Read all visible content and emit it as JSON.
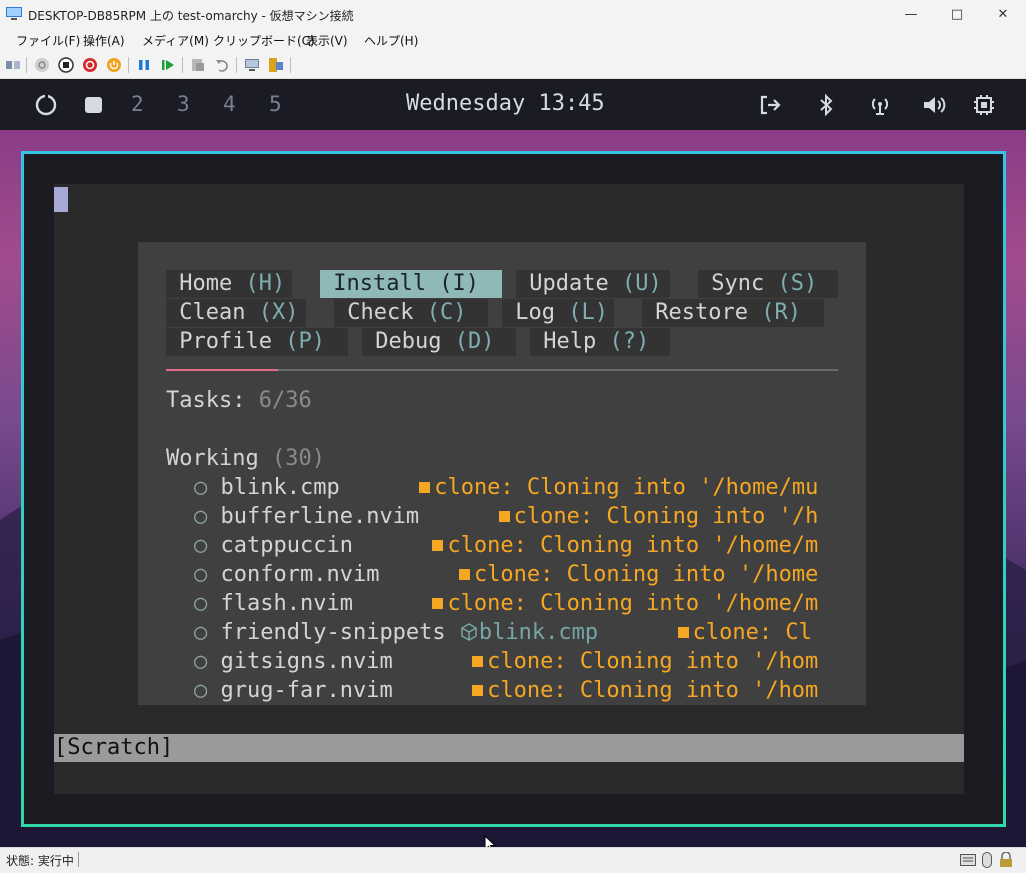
{
  "window": {
    "title": "DESKTOP-DB85RPM 上の test-omarchy - 仮想マシン接続",
    "minimize_icon": "minimize-icon",
    "maximize_icon": "maximize-icon",
    "close_icon": "close-icon"
  },
  "menu": [
    "ファイル(F)",
    "操作(A)",
    "メディア(M)",
    "クリップボード(C)",
    "表示(V)",
    "ヘルプ(H)"
  ],
  "toolbar": {
    "icons": [
      "ctrl-alt-del-icon",
      "start-icon",
      "turn-off-icon",
      "shutdown-icon",
      "power-icon",
      "pause-icon",
      "resume-icon",
      "checkpoint-icon",
      "revert-icon",
      "enhanced-session-icon",
      "share-icon"
    ]
  },
  "topbar": {
    "workspaces": [
      "2",
      "3",
      "4",
      "5"
    ],
    "clock": "Wednesday 13:45",
    "icons": [
      "logout-icon",
      "bluetooth-icon",
      "network-icon",
      "volume-icon",
      "cpu-icon"
    ]
  },
  "lazy": {
    "buttons": [
      {
        "label": "Home ",
        "key": "(H)",
        "active": false
      },
      {
        "label": "Install ",
        "key": "(I)",
        "active": true
      },
      {
        "label": "Update ",
        "key": "(U)",
        "active": false
      },
      {
        "label": "Sync ",
        "key": "(S)",
        "active": false
      },
      {
        "label": "Clean ",
        "key": "(X)",
        "active": false
      },
      {
        "label": "Check ",
        "key": "(C)",
        "active": false
      },
      {
        "label": "Log ",
        "key": "(L)",
        "active": false
      },
      {
        "label": "Restore ",
        "key": "(R)",
        "active": false
      },
      {
        "label": "Profile ",
        "key": "(P)",
        "active": false
      },
      {
        "label": "Debug ",
        "key": "(D)",
        "active": false
      },
      {
        "label": "Help ",
        "key": "(?)",
        "active": false
      }
    ],
    "tasks_label": "Tasks: ",
    "tasks_value": "6/36",
    "working_label": "Working ",
    "working_count": "(30)",
    "bullet": "○",
    "plugins": [
      {
        "name": "blink.cmp",
        "msg": "clone: Cloning into '/home/mu"
      },
      {
        "name": "bufferline.nvim",
        "msg": "clone: Cloning into '/h"
      },
      {
        "name": "catppuccin",
        "msg": "clone: Cloning into '/home/m"
      },
      {
        "name": "conform.nvim",
        "msg": "clone: Cloning into '/home"
      },
      {
        "name": "flash.nvim",
        "msg": "clone: Cloning into '/home/m"
      },
      {
        "name": "friendly-snippets",
        "dep": "blink.cmp",
        "msg": "clone: Cl"
      },
      {
        "name": "gitsigns.nvim",
        "msg": "clone: Cloning into '/hom"
      },
      {
        "name": "grug-far.nvim",
        "msg": "clone: Cloning into '/hom"
      }
    ]
  },
  "statusline": "[Scratch]",
  "statusbar": "状態: 実行中"
}
